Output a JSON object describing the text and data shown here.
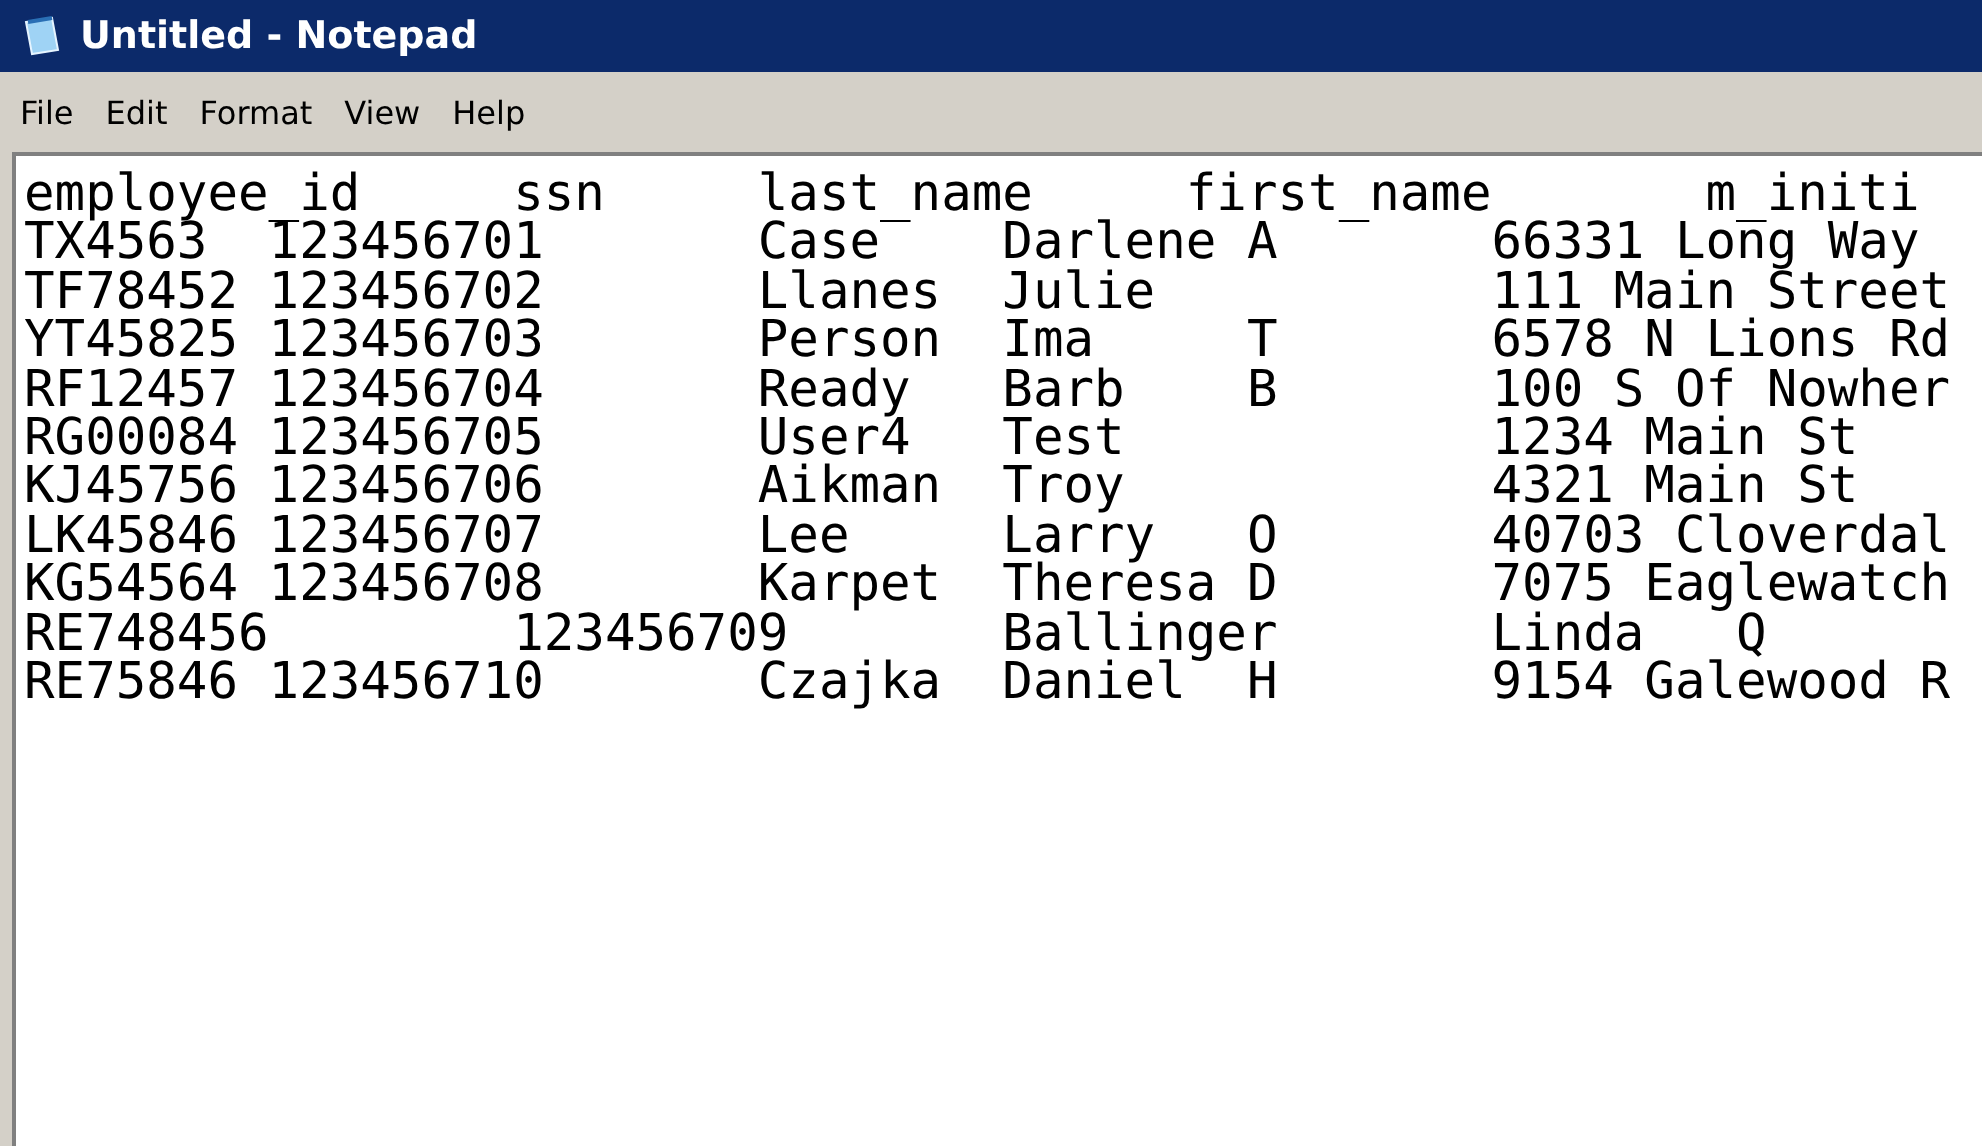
{
  "window": {
    "title": "Untitled - Notepad"
  },
  "menu": [
    "File",
    "Edit",
    "Format",
    "View",
    "Help"
  ],
  "editor": {
    "lines": [
      "employee_id     ssn     last_name     first_name       m_initi",
      "TX4563  123456701       Case    Darlene A       66331 Long Way",
      "TF78452 123456702       Llanes  Julie           111 Main Street",
      "YT45825 123456703       Person  Ima     T       6578 N Lions Rd",
      "RF12457 123456704       Ready   Barb    B       100 S Of Nowher",
      "RG00084 123456705       User4   Test            1234 Main St",
      "KJ45756 123456706       Aikman  Troy            4321 Main St",
      "LK45846 123456707       Lee     Larry   O       40703 Cloverdal",
      "KG54564 123456708       Karpet  Theresa D       7075 Eaglewatch",
      "RE748456        123456709       Ballinger       Linda   Q",
      "RE75846 123456710       Czajka  Daniel  H       9154 Galewood R"
    ]
  }
}
